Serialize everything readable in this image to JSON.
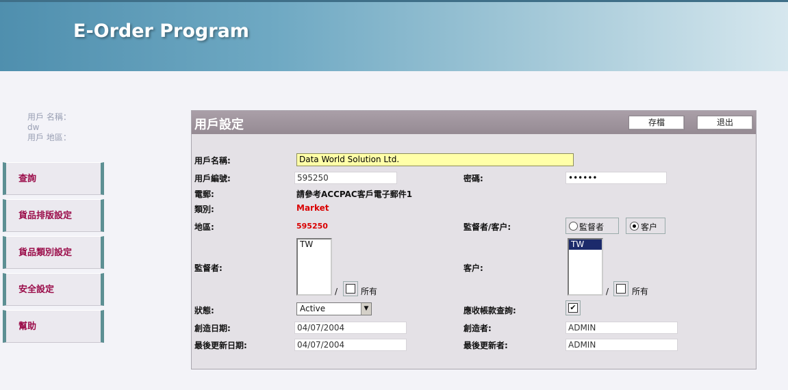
{
  "app": {
    "title": "E-Order Program"
  },
  "user_info": {
    "name_label": "用戶 名稱：",
    "name_value": "dw",
    "region_label": "用戶 地區："
  },
  "nav": {
    "items": [
      {
        "label": "查詢"
      },
      {
        "label": "貨品排版設定"
      },
      {
        "label": "貨品類別設定"
      },
      {
        "label": "安全設定"
      },
      {
        "label": "幫助"
      }
    ]
  },
  "panel": {
    "title": "用戶設定",
    "save_label": "存檔",
    "exit_label": "退出"
  },
  "form": {
    "username_label": "用戶名稱:",
    "username_value": "Data World Solution Ltd.",
    "usercode_label": "用戶編號:",
    "usercode_value": "595250",
    "password_label": "密碼:",
    "password_value": "••••••",
    "email_label": "電郵:",
    "email_value": "請參考ACCPAC客戶電子郵件1",
    "category_label": "類別:",
    "category_value": "Market",
    "region_label": "地區:",
    "region_value": "595250",
    "role_label": "監督者/客户:",
    "role_options": [
      {
        "label": "監督者",
        "selected": false
      },
      {
        "label": "客户",
        "selected": true
      }
    ],
    "supervisor_label": "監督者:",
    "supervisor_list": [
      "TW"
    ],
    "supervisor_slash": "/",
    "supervisor_all_label": "所有",
    "customer_label": "客户:",
    "customer_list": [
      "TW"
    ],
    "customer_slash": "/",
    "customer_all_label": "所有",
    "status_label": "狀態:",
    "status_value": "Active",
    "ar_query_label": "應收帳款查詢:",
    "ar_query_mark": "✔",
    "created_date_label": "創造日期:",
    "created_date_value": "04/07/2004",
    "creator_label": "創造者:",
    "creator_value": "ADMIN",
    "updated_date_label": "最後更新日期:",
    "updated_date_value": "04/07/2004",
    "updater_label": "最後更新者:",
    "updater_value": "ADMIN"
  }
}
